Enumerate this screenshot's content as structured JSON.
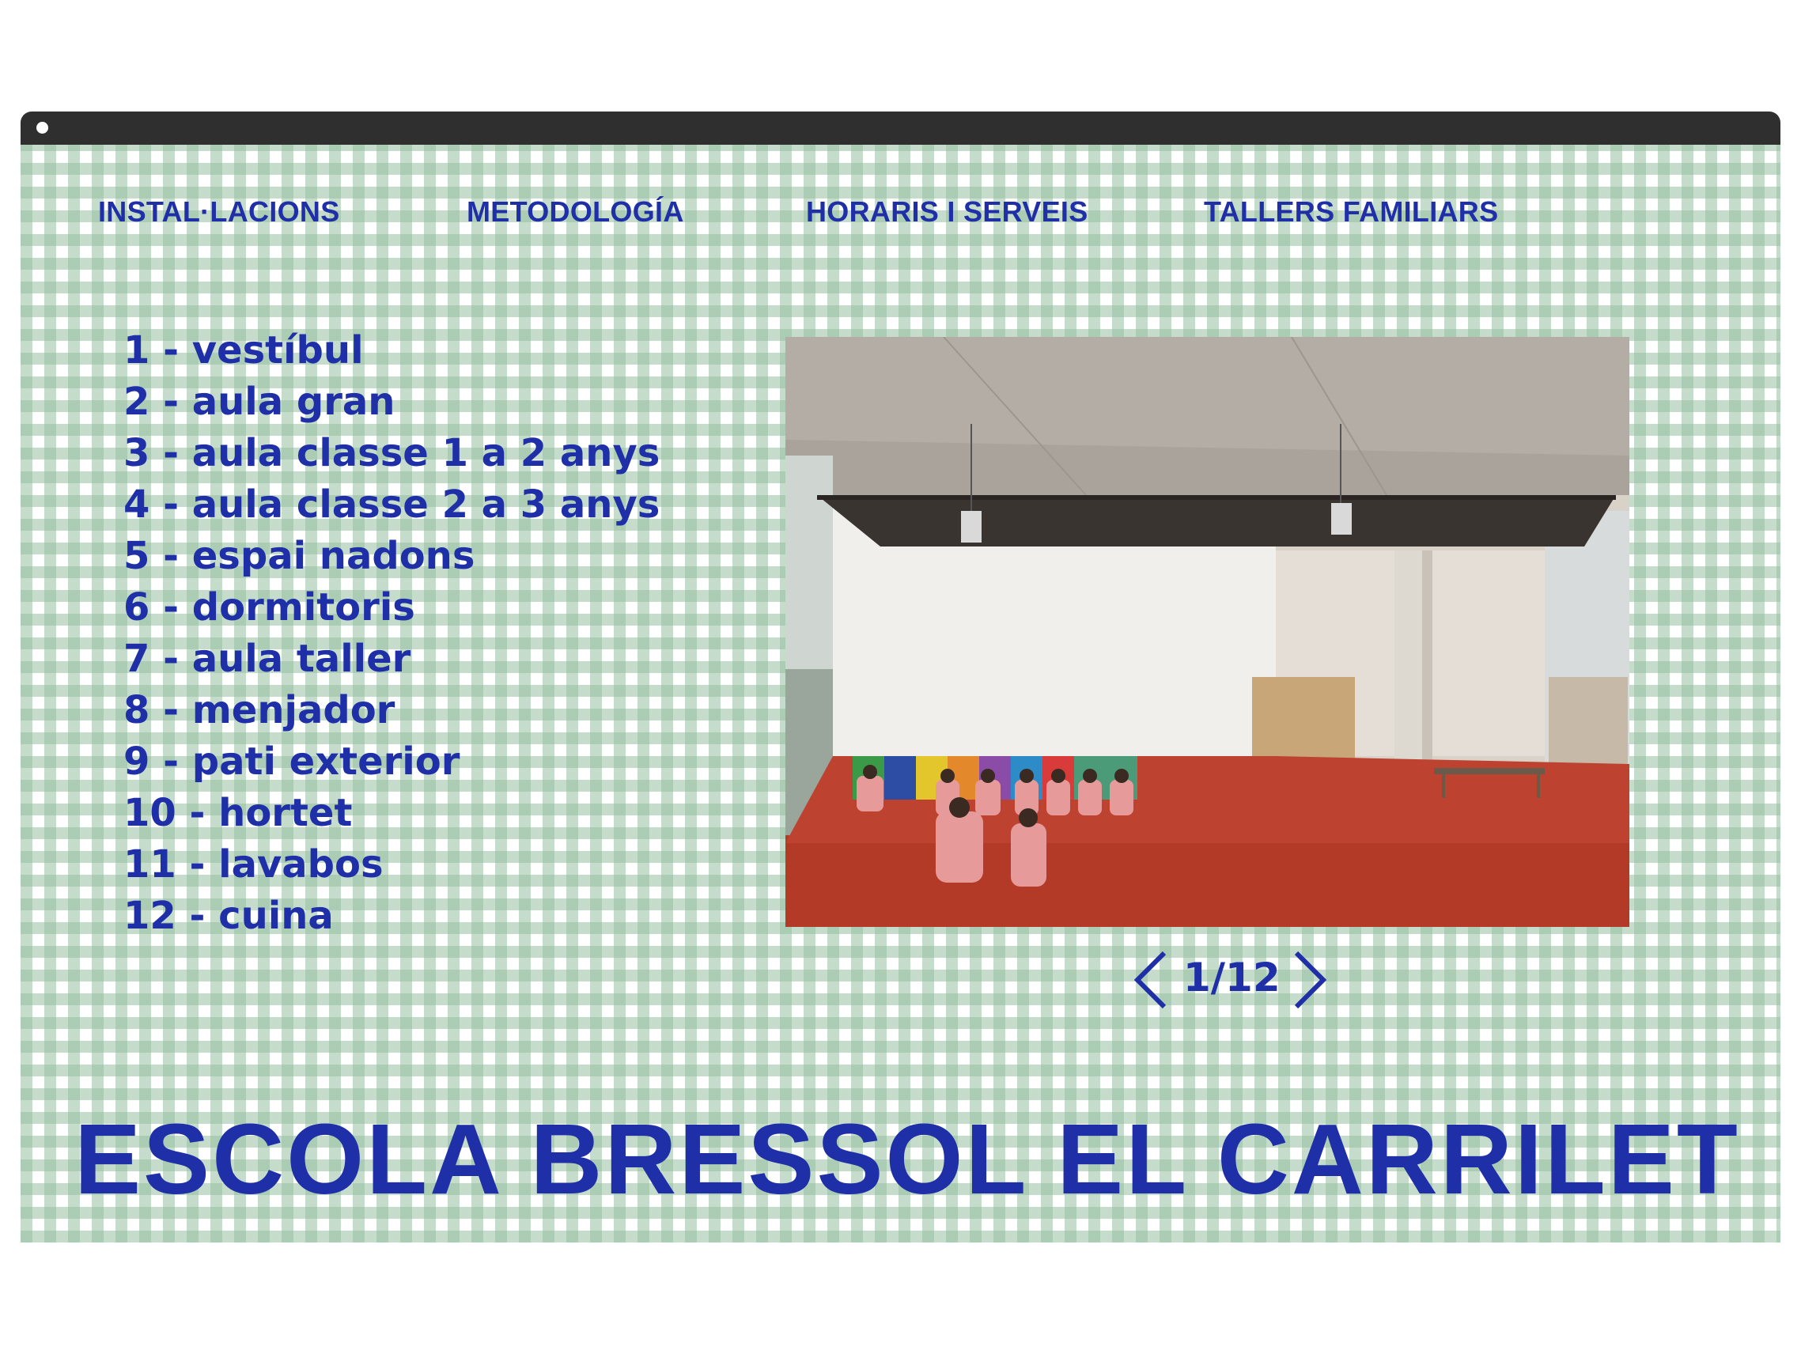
{
  "nav": {
    "items": [
      {
        "label": "INSTAL·LACIONS"
      },
      {
        "label": "METODOLOGÍA"
      },
      {
        "label": "HORARIS I SERVEIS"
      },
      {
        "label": "TALLERS FAMILIARS"
      }
    ]
  },
  "rooms": [
    "1 - vestíbul",
    "2 - aula gran",
    "3 - aula classe 1 a 2 anys",
    "4 - aula classe 2 a 3 anys",
    "5 - espai nadons",
    "6 - dormitoris",
    "7 - aula taller",
    "8 - menjador",
    "9 - pati exterior",
    "10 - hortet",
    "11 - lavabos",
    "12 - cuina"
  ],
  "gallery": {
    "current": 1,
    "total": 12,
    "counter": "1/12"
  },
  "site_title": "ESCOLA BRESSOL EL CARRILET",
  "colors": {
    "accent": "#1f2fa8",
    "gingham": "#96c0a1",
    "titlebar": "#2f2f2f"
  },
  "icons": {
    "prev": "chevron-left-icon",
    "next": "chevron-right-icon"
  }
}
